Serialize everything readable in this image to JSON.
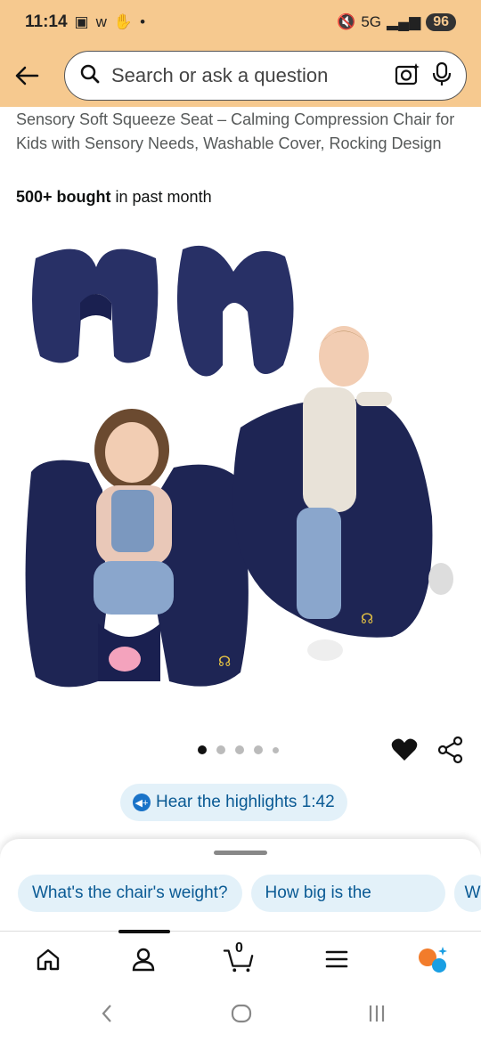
{
  "status_bar": {
    "time": "11:14",
    "left_icons": [
      "screen-record-icon",
      "w-app-icon",
      "hand-icon",
      "dot"
    ],
    "network": "5G",
    "battery": "96"
  },
  "search": {
    "placeholder": "Search or ask a question"
  },
  "product": {
    "title": "Sensory Soft Squeeze Seat – Calming Compression Chair for Kids with Sensory Needs, Washable Cover, Rocking Design",
    "bought_bold": "500+ bought",
    "bought_rest": " in past month",
    "image_count": 5,
    "active_image": 1
  },
  "audio": {
    "label": "Hear the highlights 1:42"
  },
  "suggestions": [
    "What's the chair's weight?",
    "How big is the",
    "W"
  ],
  "bottom_nav": {
    "cart_count": "0",
    "items": [
      "home-icon",
      "account-icon",
      "cart-icon",
      "menu-icon",
      "rufus-icon"
    ]
  },
  "colors": {
    "header": "#f6c98f",
    "chip_bg": "#e3f1f9",
    "chip_text": "#0a5a94",
    "cushion": "#1e2554"
  }
}
